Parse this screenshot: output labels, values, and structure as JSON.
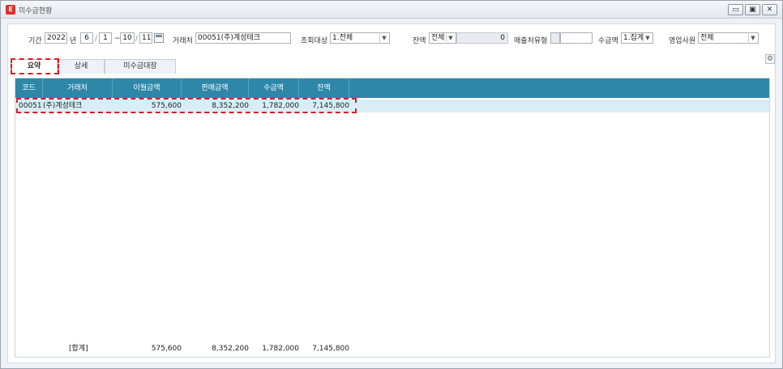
{
  "window": {
    "title": "미수금현황",
    "app_icon": "app-logo-icon",
    "controls": [
      "minimize-icon",
      "maximize-icon",
      "close-icon"
    ]
  },
  "filters": {
    "period_label": "기간",
    "year": "2022",
    "year_suffix": "년",
    "month_from": "6",
    "day_from": "1",
    "sep": "~",
    "month_to": "10",
    "day_to": "11",
    "client_label": "거래처",
    "client_value": "00051(주)계성테크",
    "target_label": "조회대상",
    "target_value": "1.전체",
    "balance_label": "잔액",
    "balance_value": "전체",
    "balance_amount": "0",
    "sales_type_label": "매출처유형",
    "collection_label": "수금액",
    "collection_value": "1.집계",
    "sales_rep_label": "영업사원",
    "sales_rep_value": "전체"
  },
  "tabs": [
    {
      "label": "요약",
      "active": true
    },
    {
      "label": "상세",
      "active": false
    },
    {
      "label": "미수금대장",
      "active": false
    }
  ],
  "table": {
    "columns": [
      "코드",
      "거래처",
      "이월금액",
      "판매금액",
      "수금액",
      "잔액"
    ],
    "rows": [
      {
        "code": "00051",
        "client": "(주)계성테크",
        "carryover": "575,600",
        "sales": "8,352,200",
        "collected": "1,782,000",
        "balance": "7,145,800"
      }
    ],
    "total": {
      "label": "[합계]",
      "carryover": "575,600",
      "sales": "8,352,200",
      "collected": "1,782,000",
      "balance": "7,145,800"
    }
  },
  "colors": {
    "header_bg": "#2e87a8",
    "selected_row": "#d9edf6",
    "highlight": "#d61f26"
  }
}
